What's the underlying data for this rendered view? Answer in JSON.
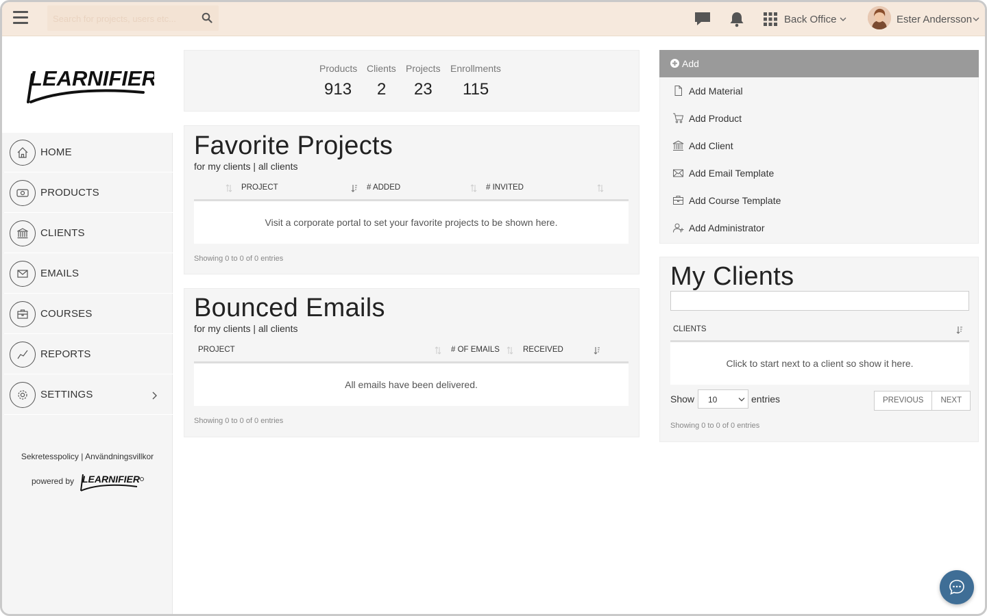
{
  "topbar": {
    "search_placeholder": "Search for projects, users etc...",
    "workspace_label": "Back Office",
    "user_name": "Ester Andersson"
  },
  "sidebar": {
    "logo_text": "LEARNIFIER",
    "items": [
      {
        "label": "HOME",
        "icon": "home-icon"
      },
      {
        "label": "PRODUCTS",
        "icon": "products-icon"
      },
      {
        "label": "CLIENTS",
        "icon": "bank-icon"
      },
      {
        "label": "EMAILS",
        "icon": "envelope-icon"
      },
      {
        "label": "COURSES",
        "icon": "briefcase-icon"
      },
      {
        "label": "REPORTS",
        "icon": "chart-line-icon"
      },
      {
        "label": "SETTINGS",
        "icon": "gear-icon"
      }
    ],
    "footer": {
      "privacy": "Sekretesspolicy",
      "separator": "|",
      "terms": "Användningsvillkor",
      "powered_by": "powered by",
      "small_logo_text": "LEARNIFIER"
    }
  },
  "stats": {
    "products_label": "Products",
    "products_value": "913",
    "clients_label": "Clients",
    "clients_value": "2",
    "projects_label": "Projects",
    "projects_value": "23",
    "enrollments_label": "Enrollments",
    "enrollments_value": "115"
  },
  "favorite_projects": {
    "title": "Favorite Projects",
    "filter_prefix": "for",
    "filter_my": "my clients",
    "filter_sep": "|",
    "filter_all": "all clients",
    "columns": [
      "PROJECT",
      "# ADDED",
      "# INVITED"
    ],
    "empty_text": "Visit a corporate portal to set your favorite projects to be shown here.",
    "showing": "Showing 0 to 0 of 0 entries"
  },
  "bounced_emails": {
    "title": "Bounced Emails",
    "filter_prefix": "for",
    "filter_my": "my clients",
    "filter_sep": "|",
    "filter_all": "all clients",
    "columns": [
      "PROJECT",
      "# OF EMAILS",
      "RECEIVED"
    ],
    "empty_text": "All emails have been delivered.",
    "showing": "Showing 0 to 0 of 0 entries"
  },
  "add_menu": {
    "header": "Add",
    "items": [
      {
        "label": "Add Material",
        "icon": "document-icon"
      },
      {
        "label": "Add Product",
        "icon": "cart-icon"
      },
      {
        "label": "Add Client",
        "icon": "bank-icon"
      },
      {
        "label": "Add Email Template",
        "icon": "envelope-icon"
      },
      {
        "label": "Add Course Template",
        "icon": "briefcase-icon"
      },
      {
        "label": "Add Administrator",
        "icon": "add-user-icon"
      }
    ]
  },
  "my_clients": {
    "title": "My Clients",
    "search_value": "",
    "column": "CLIENTS",
    "empty_text": "Click to start next to a client so show it here.",
    "show_label": "Show",
    "page_size": "10",
    "entries_label": "entries",
    "previous": "PREVIOUS",
    "next": "NEXT",
    "showing": "Showing 0 to 0 of 0 entries"
  },
  "colors": {
    "topbar_bg": "#f6e9dd",
    "sidebar_bg": "#f5f5f5",
    "add_header_bg": "#9a9a9a",
    "chat_button": "#3f6e96"
  }
}
